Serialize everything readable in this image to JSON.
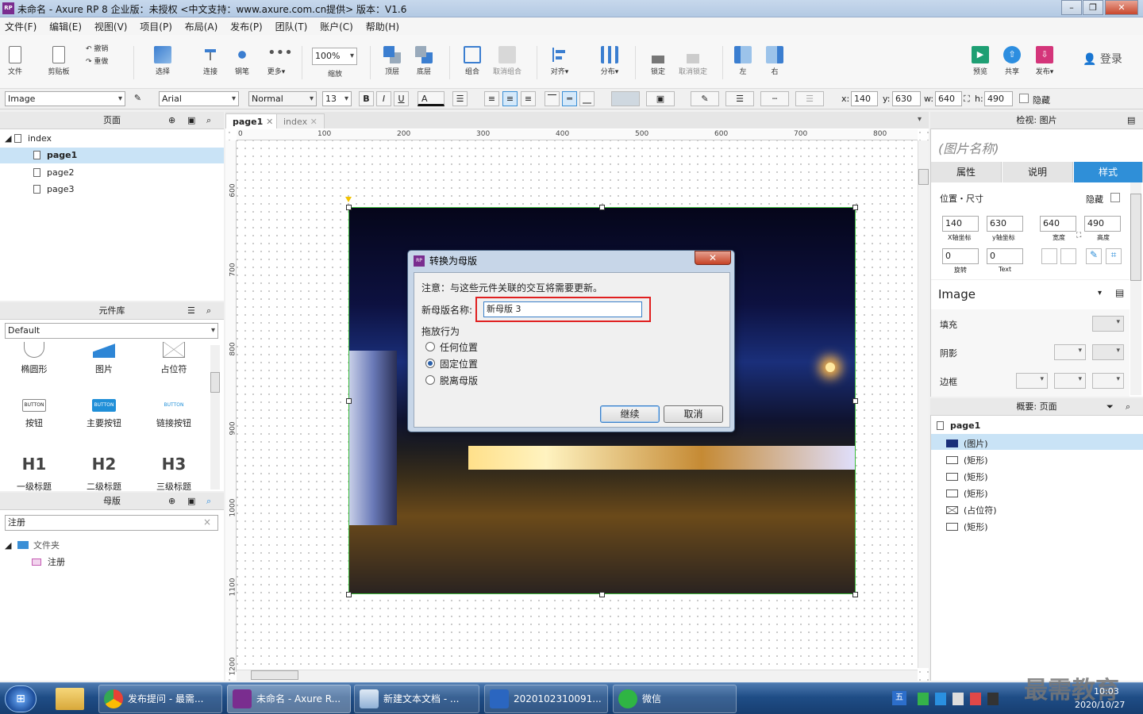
{
  "window": {
    "title": "未命名 - Axure RP 8 企业版：未授权      <中文支持：www.axure.com.cn提供> 版本：V1.6",
    "app_icon": "RP"
  },
  "menu": [
    "文件(F)",
    "编辑(E)",
    "视图(V)",
    "项目(P)",
    "布局(A)",
    "发布(P)",
    "团队(T)",
    "账户(C)",
    "帮助(H)"
  ],
  "toolbar": {
    "file": "文件",
    "clipboard": "剪贴板",
    "undo": "撤销",
    "redo": "重做",
    "select": "选择",
    "connect": "连接",
    "pen": "钢笔",
    "more": "更多▾",
    "zoom_value": "100%",
    "zoom": "缩放",
    "top": "顶层",
    "bottom": "底层",
    "group": "组合",
    "ungroup": "取消组合",
    "align": "对齐▾",
    "distribute": "分布▾",
    "lock": "锁定",
    "unlock": "取消锁定",
    "left": "左",
    "right": "右",
    "preview": "预览",
    "share": "共享",
    "publish": "发布▾",
    "login": "登录"
  },
  "format": {
    "widget_type": "Image",
    "font": "Arial",
    "style": "Normal",
    "size": "13",
    "bold": "B",
    "italic": "I",
    "underline": "U",
    "text_color": "A",
    "x_label": "x:",
    "x": "140",
    "y_label": "y:",
    "y": "630",
    "w_label": "w:",
    "w": "640",
    "h_label": "h:",
    "h": "490",
    "hidden": "隐藏"
  },
  "pages": {
    "title": "页面",
    "root": "index",
    "items": [
      "page1",
      "page2",
      "page3"
    ]
  },
  "library": {
    "title": "元件库",
    "selected": "Default",
    "widgets": [
      "椭圆形",
      "图片",
      "占位符",
      "按钮",
      "主要按钮",
      "链接按钮",
      "一级标题",
      "二级标题",
      "三级标题"
    ],
    "button_text": "BUTTON",
    "h1": "H1",
    "h2": "H2",
    "h3": "H3"
  },
  "masters": {
    "title": "母版",
    "search": "注册",
    "folder": "文件夹",
    "item": "注册"
  },
  "tabs": [
    "page1",
    "index"
  ],
  "ruler_h": [
    "0",
    "100",
    "200",
    "300",
    "400",
    "500",
    "600",
    "700",
    "800"
  ],
  "ruler_v": [
    "600",
    "700",
    "800",
    "900",
    "1000",
    "1100",
    "1200"
  ],
  "dialog": {
    "title": "转换为母版",
    "close": "✕",
    "note": "注意：与这些元件关联的交互将需要更新。",
    "name_label": "新母版名称:",
    "name_value": "新母版 3",
    "behavior_label": "拖放行为",
    "options": [
      "任何位置",
      "固定位置",
      "脱离母版"
    ],
    "selected_option": 1,
    "ok": "继续",
    "cancel": "取消"
  },
  "inspector": {
    "title": "检视: 图片",
    "name_placeholder": "(图片名称)",
    "tabs": [
      "属性",
      "说明",
      "样式"
    ],
    "active_tab": 2,
    "pos_size": "位置・尺寸",
    "hidden": "隐藏",
    "x": "140",
    "y": "630",
    "w": "640",
    "h": "490",
    "x_label": "X轴坐标",
    "y_label": "y轴坐标",
    "w_label": "宽度",
    "h_label": "高度",
    "rotate": "0",
    "text_rotate": "0",
    "rotate_label": "旋转",
    "text_label": "Text",
    "style_name": "Image",
    "fill": "填充",
    "shadow": "阴影",
    "border": "边框"
  },
  "outline": {
    "title": "概要: 页面",
    "page": "page1",
    "items": [
      "(图片)",
      "(矩形)",
      "(矩形)",
      "(矩形)",
      "(占位符)",
      "(矩形)"
    ]
  },
  "taskbar": {
    "tasks": [
      "发布提问 - 最需...",
      "未命名 - Axure R...",
      "新建文本文档 - ...",
      "2020102310091...",
      "微信"
    ],
    "time": "10:03",
    "date": "2020/10/27",
    "watermark": "最需教育"
  },
  "colors": {
    "accent": "#2f8fd8",
    "selection": "#c9e3f6",
    "highlight_box": "#e02020"
  }
}
